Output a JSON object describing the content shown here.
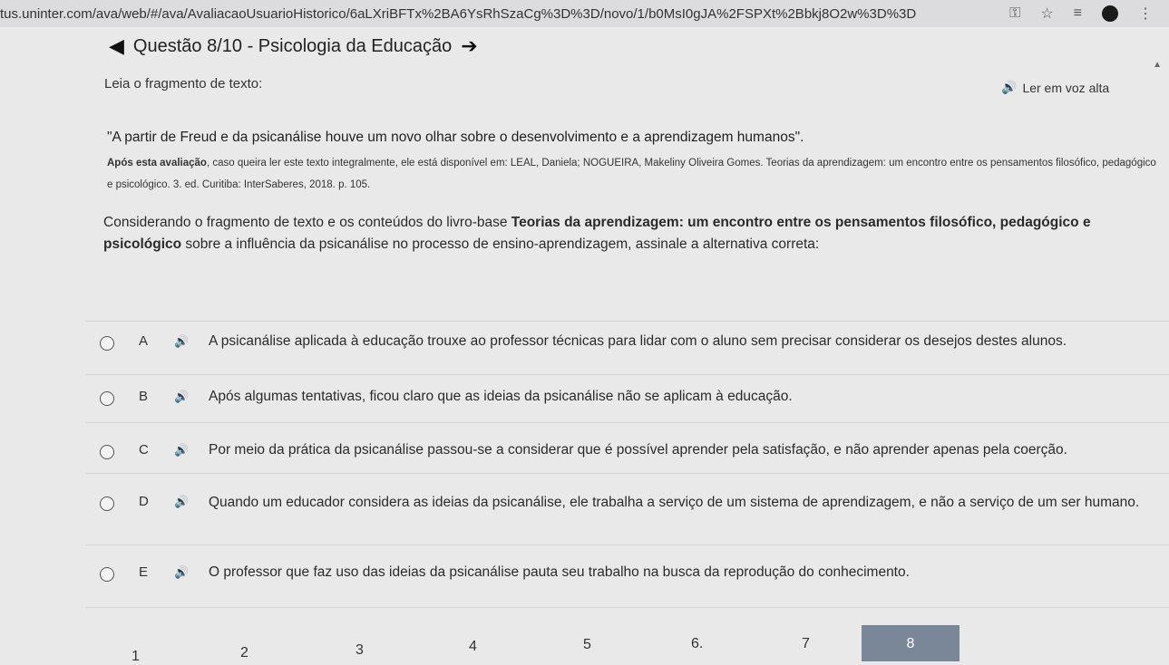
{
  "browser": {
    "url": "tus.uninter.com/ava/web/#/ava/AvaliacaoUsuarioHistorico/6aLXriBFTx%2BA6YsRhSzaCg%3D%3D/novo/1/b0MsI0gJA%2FSPXt%2Bbkj8O2w%3D%3D",
    "icons": [
      "key-icon",
      "star-icon",
      "menu-icon",
      "profile-icon",
      "more-icon"
    ]
  },
  "header": {
    "title": "Questão 8/10 - Psicologia da Educação"
  },
  "question": {
    "lead": "Leia o fragmento de texto:",
    "read_aloud": "Ler em voz alta",
    "quote": "\"A partir de Freud e da psicanálise houve um novo olhar sobre o desenvolvimento e a aprendizagem humanos\".",
    "source_bold": "Após esta avaliação",
    "source_rest": ", caso queira ler este texto integralmente, ele está disponível em: LEAL, Daniela; NOGUEIRA, Makeliny Oliveira Gomes. Teorias da aprendizagem: um encontro entre os pensamentos filosófico, pedagógico e psicológico. 3. ed. Curitiba: InterSaberes, 2018. p. 105.",
    "prompt_start": "Considerando o fragmento de texto e os conteúdos do livro-base ",
    "prompt_bold": "Teorias da aprendizagem: um encontro entre os pensamentos filosófico, pedagógico e psicológico",
    "prompt_end": " sobre a influência da psicanálise no processo de ensino-aprendizagem, assinale a alternativa correta:"
  },
  "options": [
    {
      "letter": "A",
      "text": "A psicanálise aplicada à educação trouxe ao professor técnicas para lidar com o aluno sem precisar considerar os desejos destes alunos."
    },
    {
      "letter": "B",
      "text": "Após algumas tentativas, ficou claro que as ideias da psicanálise não se aplicam à educação."
    },
    {
      "letter": "C",
      "text": "Por meio da prática da psicanálise passou-se a considerar que é possível aprender pela satisfação, e não aprender apenas pela coerção."
    },
    {
      "letter": "D",
      "text": "Quando um educador considera as ideias da psicanálise, ele trabalha a serviço de um sistema de aprendizagem, e não a serviço de um ser humano."
    },
    {
      "letter": "E",
      "text": "O professor que faz uso das ideias da psicanálise pauta seu trabalho na busca da reprodução do conhecimento."
    }
  ],
  "pagination": {
    "pages": [
      "1",
      "2",
      "3",
      "4",
      "5",
      "6.",
      "7",
      "8"
    ],
    "current": "8"
  }
}
